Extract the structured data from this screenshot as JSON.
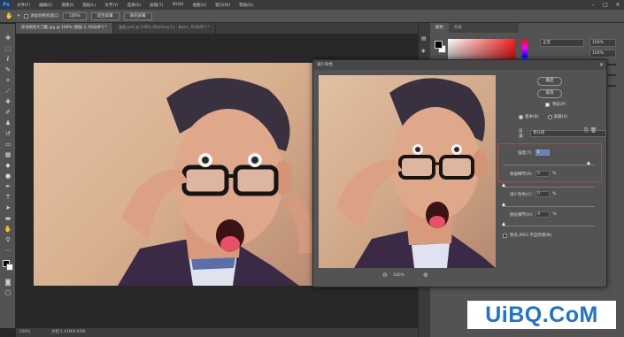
{
  "app": {
    "logo": "Ps",
    "menu": [
      "文件(F)",
      "编辑(E)",
      "图像(I)",
      "图层(L)",
      "文字(Y)",
      "选择(S)",
      "滤镜(T)",
      "3D(D)",
      "视图(V)",
      "窗口(W)",
      "帮助(H)"
    ]
  },
  "options_bar": {
    "checkbox_label": "添加到所有窗口",
    "zoom": "100%",
    "fit_screen": "适合屏幕",
    "fill_screen": "填充屏幕"
  },
  "doc_tabs": [
    {
      "label": "惊讶搞怪大刀酷.jpg @ 100% (图层 2, RGB/8*) *",
      "active": true
    },
    {
      "label": "油画.psd @ 100% (Painting Fx - Basic, RGB/8*) *",
      "active": false
    }
  ],
  "status": {
    "zoom": "100%",
    "doc": "文档:1.41M/9.65M"
  },
  "right_panel": {
    "tabs": [
      "颜色",
      "色板"
    ],
    "blend_mode": "正常",
    "field_a": "100%",
    "field_b": "100%"
  },
  "dialog": {
    "title": "减少杂色",
    "ok": "确定",
    "cancel": "取消",
    "preview_label": "预览(P)",
    "mode_basic": "基本(B)",
    "mode_advanced": "高级(A)",
    "settings_label": "设置:",
    "settings_value": "默认值",
    "strength_label": "强度(T):",
    "strength_value": "0",
    "preserve_label": "保留细节(R):",
    "preserve_value": "0",
    "preserve_unit": "%",
    "reduce_color_label": "减少杂色(C):",
    "reduce_color_value": "0",
    "reduce_color_unit": "%",
    "sharpen_label": "锐化细节(H):",
    "sharpen_value": "0",
    "sharpen_unit": "%",
    "jpeg_label": "移去 JPEG 不自然感(N)",
    "zoom_level": "100%"
  },
  "watermark": "UiBQ.CoM"
}
